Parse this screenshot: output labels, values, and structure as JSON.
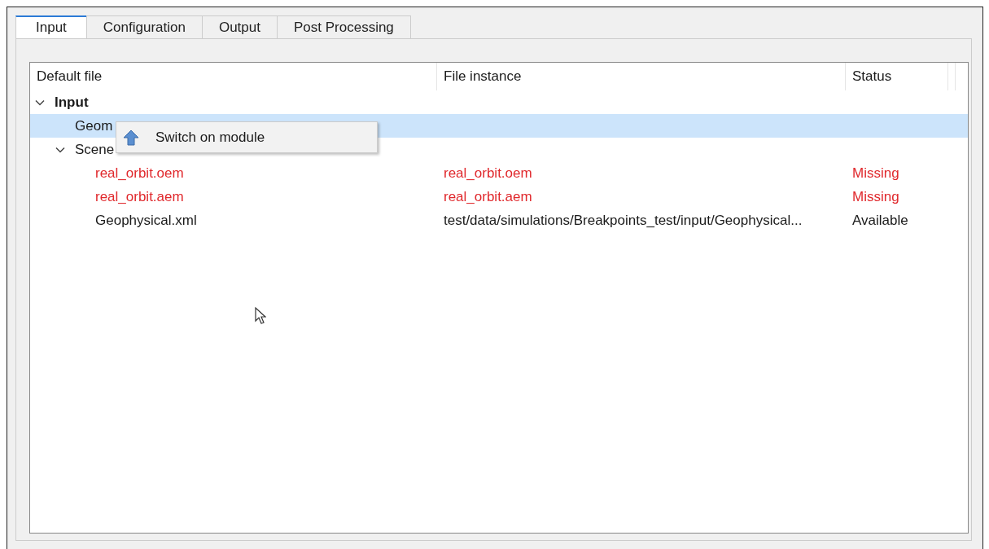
{
  "tabs": [
    {
      "label": "Input",
      "selected": true
    },
    {
      "label": "Configuration",
      "selected": false
    },
    {
      "label": "Output",
      "selected": false
    },
    {
      "label": "Post Processing",
      "selected": false
    }
  ],
  "table": {
    "columns": [
      "Default file",
      "File instance",
      "Status"
    ],
    "rows": [
      {
        "name": "Input",
        "expanded": true,
        "selected": false,
        "children": [
          {
            "name": "Geom",
            "selected": true
          },
          {
            "name": "Scene",
            "expanded": true,
            "selected": false,
            "children": [
              {
                "name": "real_orbit.oem",
                "instance": "real_orbit.oem",
                "status": "Missing",
                "missing": true,
                "selected": false
              },
              {
                "name": "real_orbit.aem",
                "instance": "real_orbit.aem",
                "status": "Missing",
                "missing": true,
                "selected": false
              },
              {
                "name": "Geophysical.xml",
                "instance": "test/data/simulations/Breakpoints_test/input/Geophysical...",
                "status": "Available",
                "missing": false,
                "selected": false
              }
            ]
          }
        ]
      }
    ]
  },
  "context_menu": {
    "items": [
      {
        "label": "Switch on module"
      }
    ]
  }
}
